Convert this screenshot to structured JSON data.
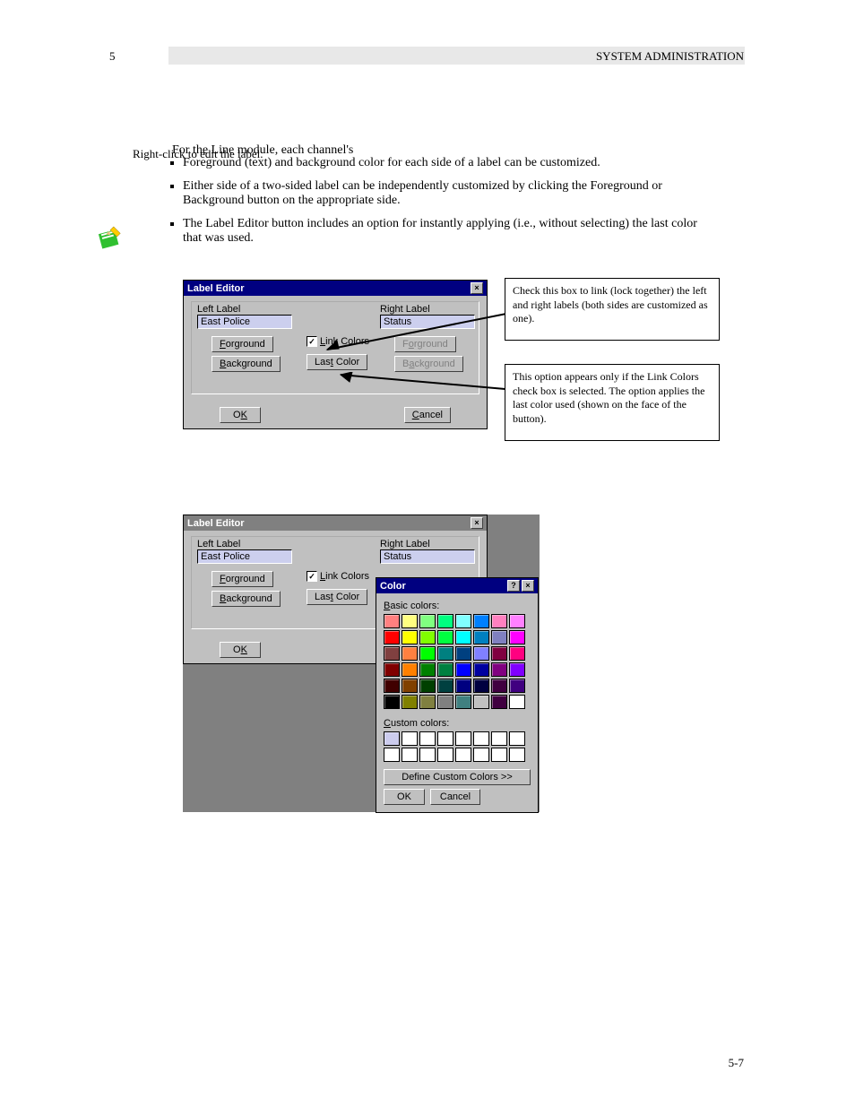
{
  "doc": {
    "section_num": "5",
    "chapter_title": "SYSTEM ADMINISTRATION",
    "page_num": "5-7",
    "bullet_intro_1": "For the Line module, each channel's",
    "bullet_intro_2": "Right-click to edit the label.",
    "bullet_intro_3": "The Label Editor button includes an option for instantly applying (i.e., without",
    "bullet1": "Foreground (text) and background color for each side of a label can be customized.",
    "bullet2": "Either side of a two-sided label can be independently customized by clicking the Foreground or Background button on the appropriate side.",
    "bullet3": "selecting) the last color that was used."
  },
  "callout1": {
    "line1": "Check this box to link (lock together)",
    "line2": "the left and right labels (both sides",
    "line3": "are customized as one)."
  },
  "callout2": {
    "line1": "This option appears only if the Link",
    "line2": "Colors check box is selected. The",
    "line3": "option applies the last color used",
    "line4": "(shown on the face of the button)."
  },
  "labelEditor1": {
    "title": "Label Editor",
    "leftLabel": "Left Label",
    "leftValue": "East Police",
    "rightLabel": "Right Label",
    "rightValue": "Status",
    "forground": "Forground",
    "background": "Background",
    "linkColors": "Link Colors",
    "lastColor": "Last Color",
    "ok": "OK",
    "cancel": "Cancel"
  },
  "labelEditor2": {
    "title": "Label Editor",
    "leftLabel": "Left Label",
    "leftValue": "East Police",
    "rightLabel": "Right Label",
    "rightValue": "Status",
    "forground": "Forground",
    "background": "Background",
    "linkColors": "Link Colors",
    "lastColor": "Last Color",
    "ok": "OK"
  },
  "colorDialog": {
    "title": "Color",
    "basicColors": "Basic colors:",
    "customColors": "Custom colors:",
    "defineCustom": "Define Custom Colors >>",
    "ok": "OK",
    "cancel": "Cancel",
    "basicPalette": [
      "#ff8080",
      "#ffff80",
      "#80ff80",
      "#00ff80",
      "#80ffff",
      "#0080ff",
      "#ff80c0",
      "#ff80ff",
      "#ff0000",
      "#ffff00",
      "#80ff00",
      "#00ff40",
      "#00ffff",
      "#0080c0",
      "#8080c0",
      "#ff00ff",
      "#804040",
      "#ff8040",
      "#00ff00",
      "#008080",
      "#004080",
      "#8080ff",
      "#800040",
      "#ff0080",
      "#800000",
      "#ff8000",
      "#008000",
      "#008040",
      "#0000ff",
      "#0000a0",
      "#800080",
      "#8000ff",
      "#400000",
      "#804000",
      "#004000",
      "#004040",
      "#000080",
      "#000040",
      "#400040",
      "#400080",
      "#000000",
      "#808000",
      "#808040",
      "#808080",
      "#408080",
      "#c0c0c0",
      "#400040",
      "#ffffff"
    ],
    "customPalette": [
      "#ccccee",
      "#ffffff",
      "#ffffff",
      "#ffffff",
      "#ffffff",
      "#ffffff",
      "#ffffff",
      "#ffffff",
      "#ffffff",
      "#ffffff",
      "#ffffff",
      "#ffffff",
      "#ffffff",
      "#ffffff",
      "#ffffff",
      "#ffffff"
    ]
  }
}
